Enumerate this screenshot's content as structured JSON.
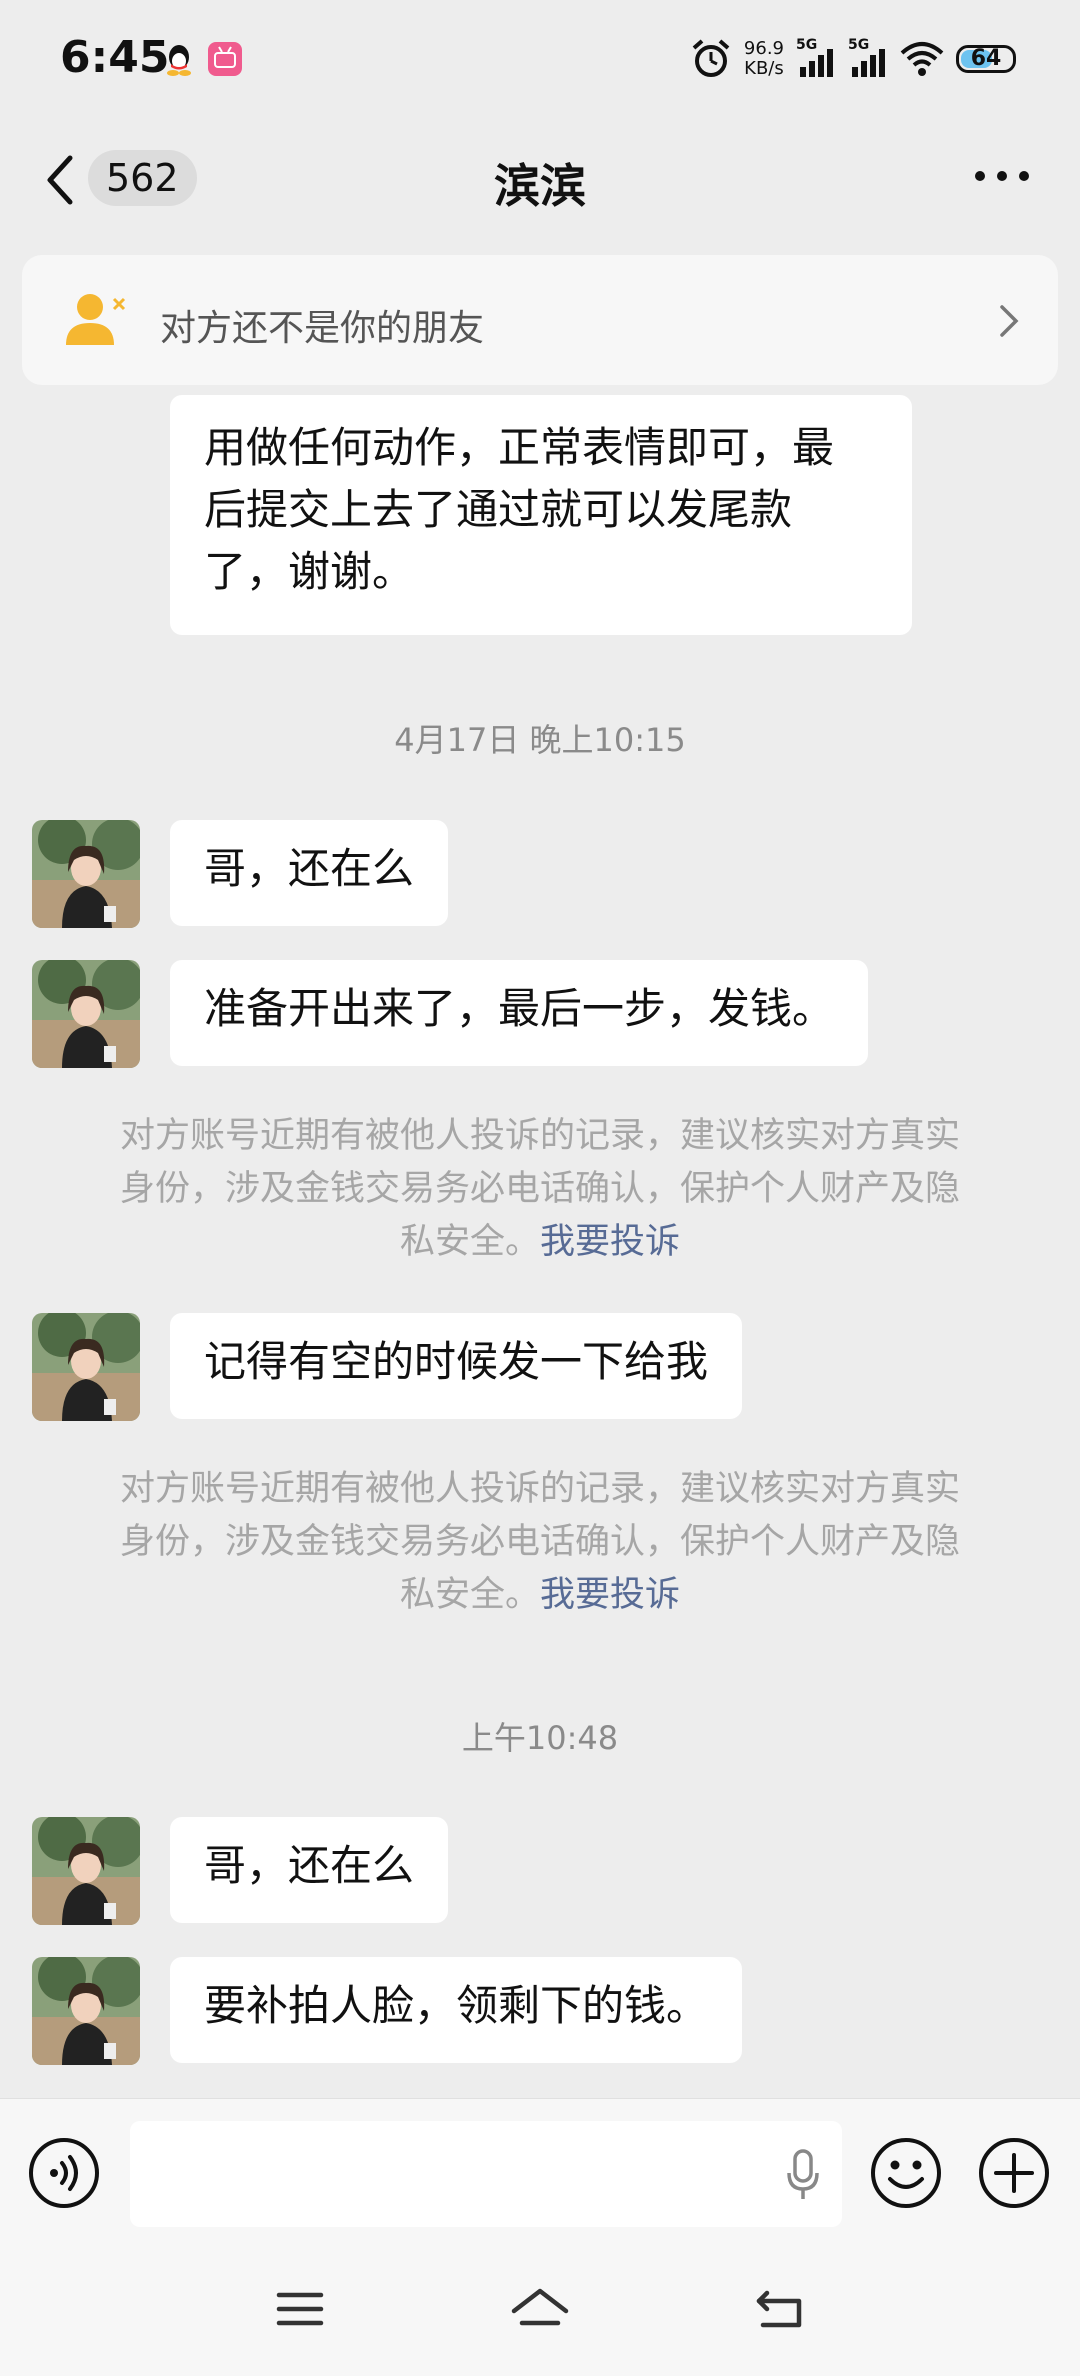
{
  "status_bar": {
    "time": "6:45",
    "net_speed_value": "96.9",
    "net_speed_unit": "KB/s",
    "signal1_label": "5G",
    "signal2_label": "5G",
    "battery_level": "64",
    "battery_fraction": 0.64,
    "app_icons": [
      "qq-icon",
      "bilibili-icon"
    ]
  },
  "header": {
    "unread_count": "562",
    "title": "滨滨"
  },
  "banner": {
    "text": "对方还不是你的朋友"
  },
  "messages": {
    "m0_lines": [
      "用做任何动作，正常表情即可，最",
      "后提交上去了通过就可以发尾款",
      "了，谢谢。"
    ],
    "ts1": "4月17日 晚上10:15",
    "m1": "哥，还在么",
    "m2": "准备开出来了，最后一步，发钱。",
    "w1_line1": "对方账号近期有被他人投诉的记录，建议核实对方真实",
    "w1_line2": "身份，涉及金钱交易务必电话确认，保护个人财产及隐",
    "w1_line3": "私安全。",
    "w1_link": "我要投诉",
    "m3": "记得有空的时候发一下给我",
    "w2_line1": "对方账号近期有被他人投诉的记录，建议核实对方真实",
    "w2_line2": "身份，涉及金钱交易务必电话确认，保护个人财产及隐",
    "w2_line3": "私安全。",
    "w2_link": "我要投诉",
    "ts2": "上午10:48",
    "m4": "哥，还在么",
    "m5": "要补拍人脸，领剩下的钱。"
  },
  "colors": {
    "background": "#ededed",
    "bubble": "#ffffff",
    "link": "#576b95",
    "banner_icon": "#f5b731"
  }
}
